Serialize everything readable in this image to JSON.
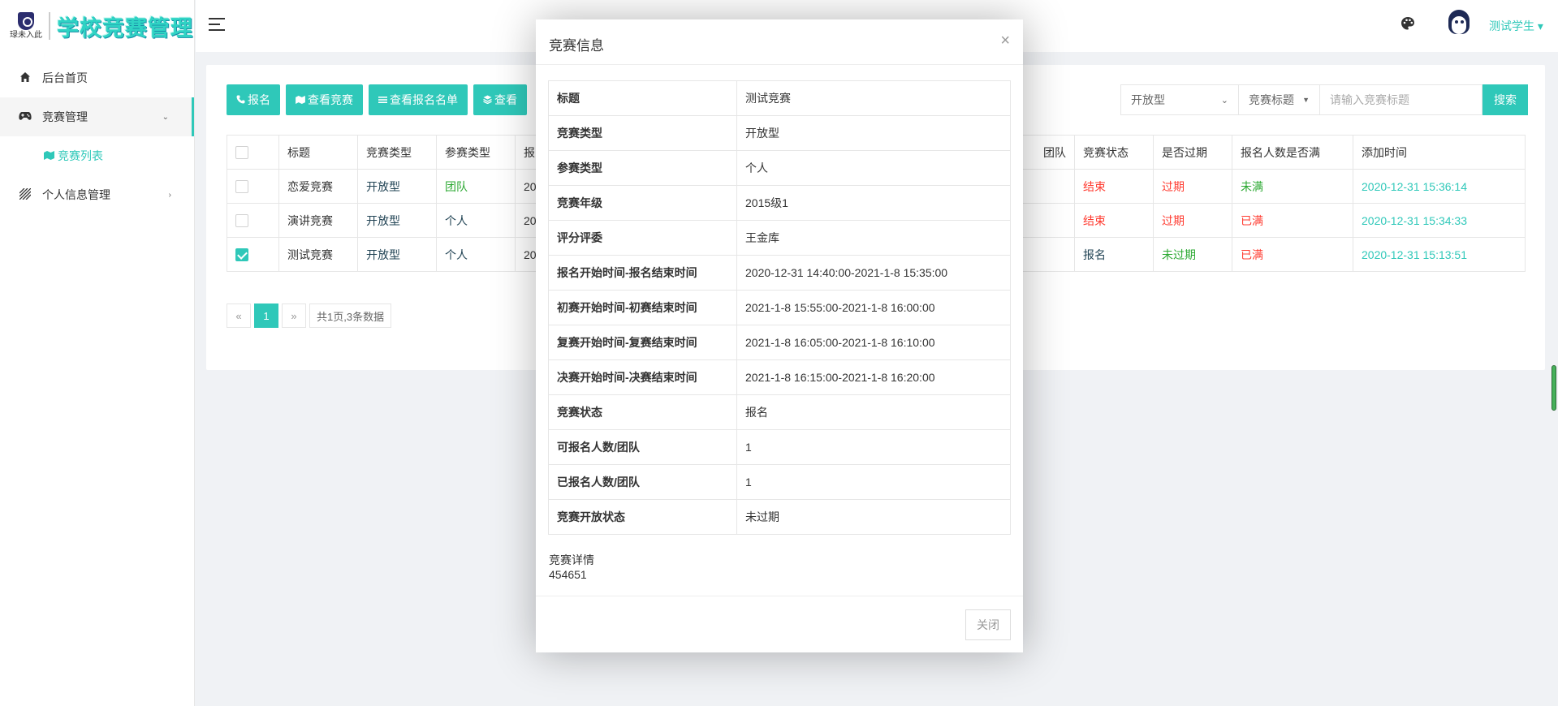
{
  "brand": {
    "mark_text": "琭未入此",
    "title": "学校竞赛管理"
  },
  "sidebar": {
    "items": [
      {
        "label": "后台首页",
        "icon": "home-icon"
      },
      {
        "label": "竞赛管理",
        "icon": "gamepad-icon",
        "arrow": "chevron-down-icon"
      },
      {
        "label": "竞赛列表",
        "icon": "map-icon",
        "sub": true
      },
      {
        "label": "个人信息管理",
        "icon": "stripes-icon",
        "arrow": "chevron-right-icon"
      }
    ]
  },
  "header": {
    "user_name": "测试学生",
    "user_caret": "▾"
  },
  "toolbar": {
    "buttons": [
      "报名",
      "查看竞赛",
      "查看报名名单",
      "查看"
    ]
  },
  "filters": {
    "type_select": "开放型",
    "field_select": "竞赛标题",
    "search_placeholder": "请输入竞赛标题",
    "search_button": "搜索"
  },
  "table": {
    "headers": [
      "标题",
      "竞赛类型",
      "参赛类型",
      "报",
      "团队",
      "竞赛状态",
      "是否过期",
      "报名人数是否满",
      "添加时间"
    ],
    "rows": [
      {
        "checked": false,
        "title": "恋爱竞赛",
        "type": "开放型",
        "participant": "团队",
        "reg": "20",
        "status": "结束",
        "expired": "过期",
        "full": "未满",
        "added": "2020-12-31 15:36:14"
      },
      {
        "checked": false,
        "title": "演讲竞赛",
        "type": "开放型",
        "participant": "个人",
        "reg": "20",
        "status": "结束",
        "expired": "过期",
        "full": "已满",
        "added": "2020-12-31 15:34:33"
      },
      {
        "checked": true,
        "title": "测试竞赛",
        "type": "开放型",
        "participant": "个人",
        "reg": "20",
        "status": "报名",
        "expired": "未过期",
        "full": "已满",
        "added": "2020-12-31 15:13:51"
      }
    ]
  },
  "pager": {
    "prev": "«",
    "current": "1",
    "next": "»",
    "count": "共1页,3条数据"
  },
  "modal": {
    "title": "竞赛信息",
    "close_glyph": "×",
    "rows": [
      {
        "k": "标题",
        "v": "测试竞赛"
      },
      {
        "k": "竞赛类型",
        "v": "开放型"
      },
      {
        "k": "参赛类型",
        "v": "个人"
      },
      {
        "k": "竞赛年级",
        "v": "2015级1"
      },
      {
        "k": "评分评委",
        "v": "王金库"
      },
      {
        "k": "报名开始时间-报名结束时间",
        "v": "2020-12-31 14:40:00-2021-1-8 15:35:00"
      },
      {
        "k": "初赛开始时间-初赛结束时间",
        "v": "2021-1-8 15:55:00-2021-1-8 16:00:00"
      },
      {
        "k": "复赛开始时间-复赛结束时间",
        "v": "2021-1-8 16:05:00-2021-1-8 16:10:00"
      },
      {
        "k": "决赛开始时间-决赛结束时间",
        "v": "2021-1-8 16:15:00-2021-1-8 16:20:00"
      },
      {
        "k": "竞赛状态",
        "v": "报名"
      },
      {
        "k": "可报名人数/团队",
        "v": "1"
      },
      {
        "k": "已报名人数/团队",
        "v": "1"
      },
      {
        "k": "竞赛开放状态",
        "v": "未过期"
      }
    ],
    "detail_label": "竞赛详情",
    "detail_value": "454651",
    "close_button": "关闭"
  },
  "colors": {
    "accent": "#2fc8b9",
    "danger": "#ff3b30",
    "success": "#2aa830"
  }
}
